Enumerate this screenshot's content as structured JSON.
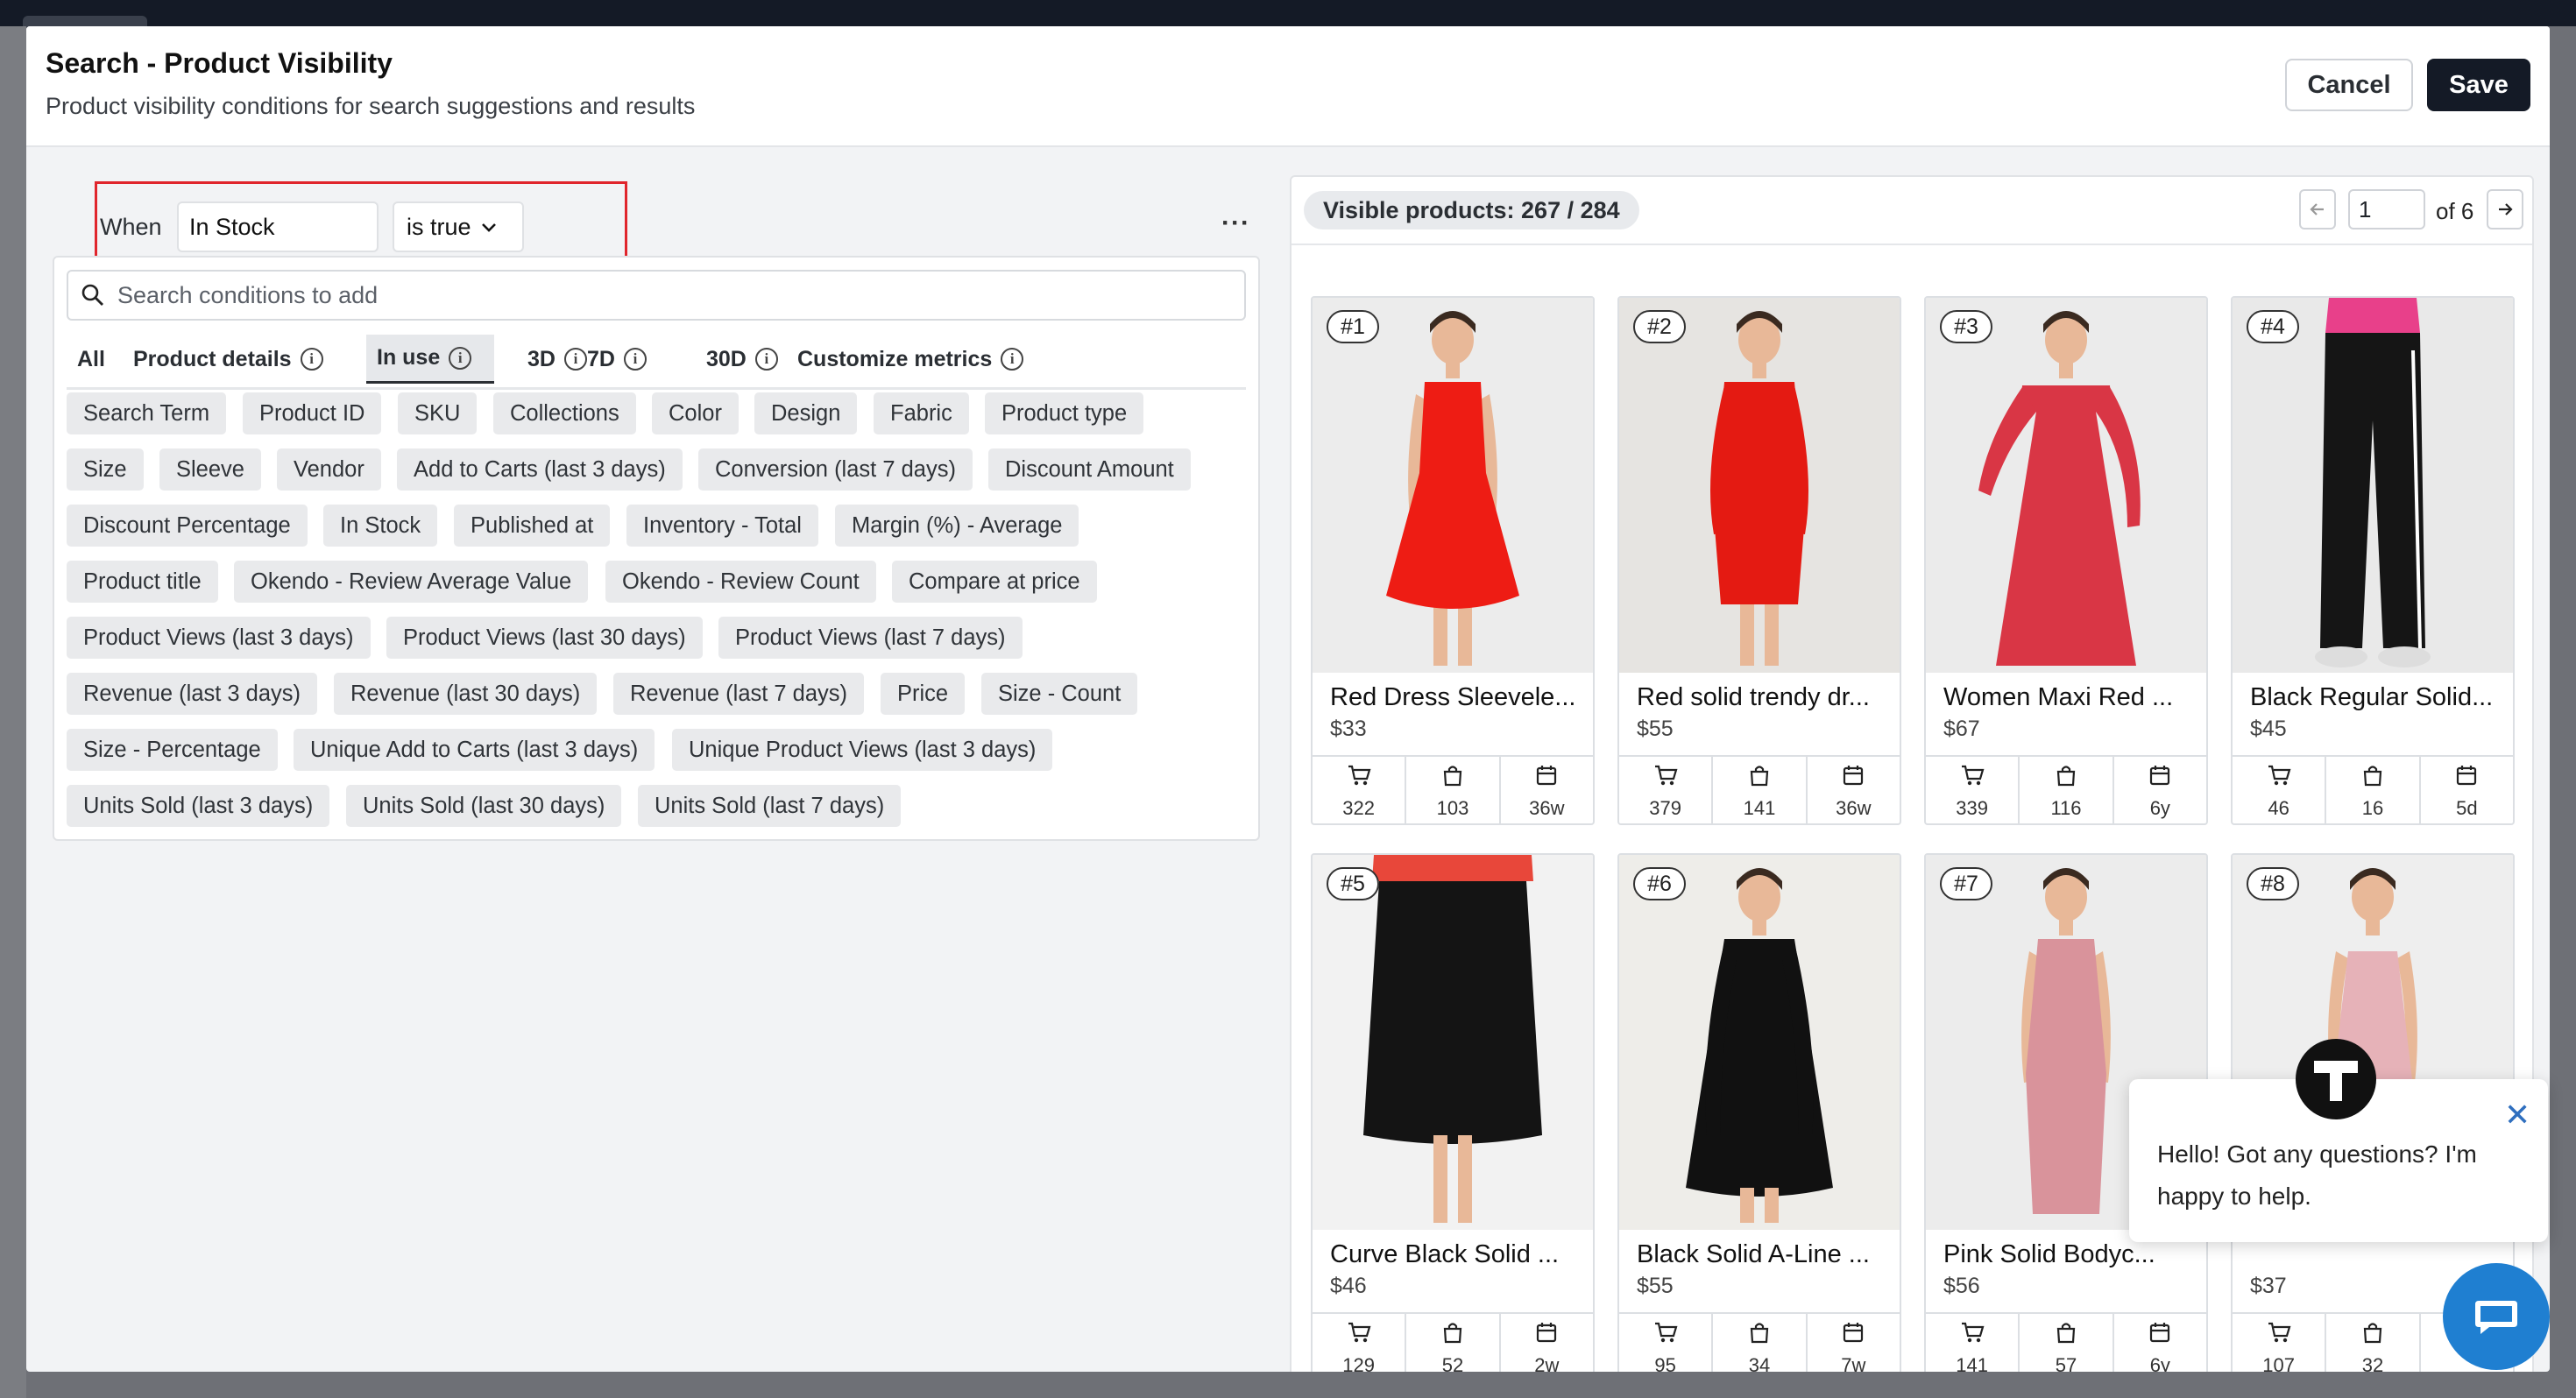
{
  "modal": {
    "title": "Search - Product Visibility",
    "subtitle": "Product visibility conditions for search suggestions and results",
    "cancel_label": "Cancel",
    "save_label": "Save"
  },
  "condition": {
    "when_label": "When",
    "field": "In Stock",
    "operator": "is true",
    "more_label": "···"
  },
  "conditions_panel": {
    "search_placeholder": "Search conditions to add",
    "tabs": [
      {
        "label": "All",
        "info": false,
        "active": false
      },
      {
        "label": "Product details",
        "info": true,
        "active": false
      },
      {
        "label": "In use",
        "info": true,
        "active": true
      },
      {
        "label": "3D",
        "info": true,
        "active": false
      },
      {
        "label": "7D",
        "info": true,
        "active": false
      },
      {
        "label": "30D",
        "info": true,
        "active": false
      },
      {
        "label": "Customize metrics",
        "info": true,
        "active": false
      }
    ],
    "chips": [
      [
        "Search Term",
        "Product ID",
        "SKU",
        "Collections",
        "Color",
        "Design",
        "Fabric",
        "Product type"
      ],
      [
        "Size",
        "Sleeve",
        "Vendor",
        "Add to Carts (last 3 days)",
        "Conversion (last 7 days)",
        "Discount Amount"
      ],
      [
        "Discount Percentage",
        "In Stock",
        "Published at",
        "Inventory - Total",
        "Margin (%) - Average"
      ],
      [
        "Product title",
        "Okendo - Review Average Value",
        "Okendo - Review Count",
        "Compare at price"
      ],
      [
        "Product Views (last 3 days)",
        "Product Views (last 30 days)",
        "Product Views (last 7 days)"
      ],
      [
        "Revenue (last 3 days)",
        "Revenue (last 30 days)",
        "Revenue (last 7 days)",
        "Price",
        "Size - Count"
      ],
      [
        "Size - Percentage",
        "Unique Add to Carts (last 3 days)",
        "Unique Product Views (last 3 days)"
      ],
      [
        "Units Sold (last 3 days)",
        "Units Sold (last 30 days)",
        "Units Sold (last 7 days)"
      ]
    ]
  },
  "preview": {
    "visible_label": "Visible products: 267 / 284",
    "page_value": "1",
    "page_of": "of 6"
  },
  "products": [
    {
      "rank": "#1",
      "name": "Red Dress Sleevele...",
      "price": "$33",
      "carts": "322",
      "sold": "103",
      "age": "36w",
      "dress_color": "#ee1c14",
      "style": "sleeveless"
    },
    {
      "rank": "#2",
      "name": "Red solid trendy dr...",
      "price": "$55",
      "carts": "379",
      "sold": "141",
      "age": "36w",
      "dress_color": "#e41a12",
      "style": "sheath"
    },
    {
      "rank": "#3",
      "name": "Women Maxi Red ...",
      "price": "$67",
      "carts": "339",
      "sold": "116",
      "age": "6y",
      "dress_color": "#d93645",
      "style": "maxi"
    },
    {
      "rank": "#4",
      "name": "Black Regular Solid...",
      "price": "$45",
      "carts": "46",
      "sold": "16",
      "age": "5d",
      "dress_color": "#151515",
      "style": "pants"
    },
    {
      "rank": "#5",
      "name": "Curve Black Solid ...",
      "price": "$46",
      "carts": "129",
      "sold": "52",
      "age": "2w",
      "dress_color": "#141414",
      "style": "skirt"
    },
    {
      "rank": "#6",
      "name": "Black Solid A-Line ...",
      "price": "$55",
      "carts": "95",
      "sold": "34",
      "age": "7w",
      "dress_color": "#111111",
      "style": "aline"
    },
    {
      "rank": "#7",
      "name": "Pink Solid Bodyc...",
      "price": "$56",
      "carts": "141",
      "sold": "57",
      "age": "6y",
      "dress_color": "#d9939b",
      "style": "bodycon"
    },
    {
      "rank": "#8",
      "name": "",
      "price": "$37",
      "carts": "107",
      "sold": "32",
      "age": "",
      "dress_color": "#e6b2b8",
      "style": "slip"
    }
  ],
  "chat": {
    "message": "Hello! Got any questions? I'm happy to help.",
    "close_label": "✕",
    "avatar_letter": "T"
  }
}
